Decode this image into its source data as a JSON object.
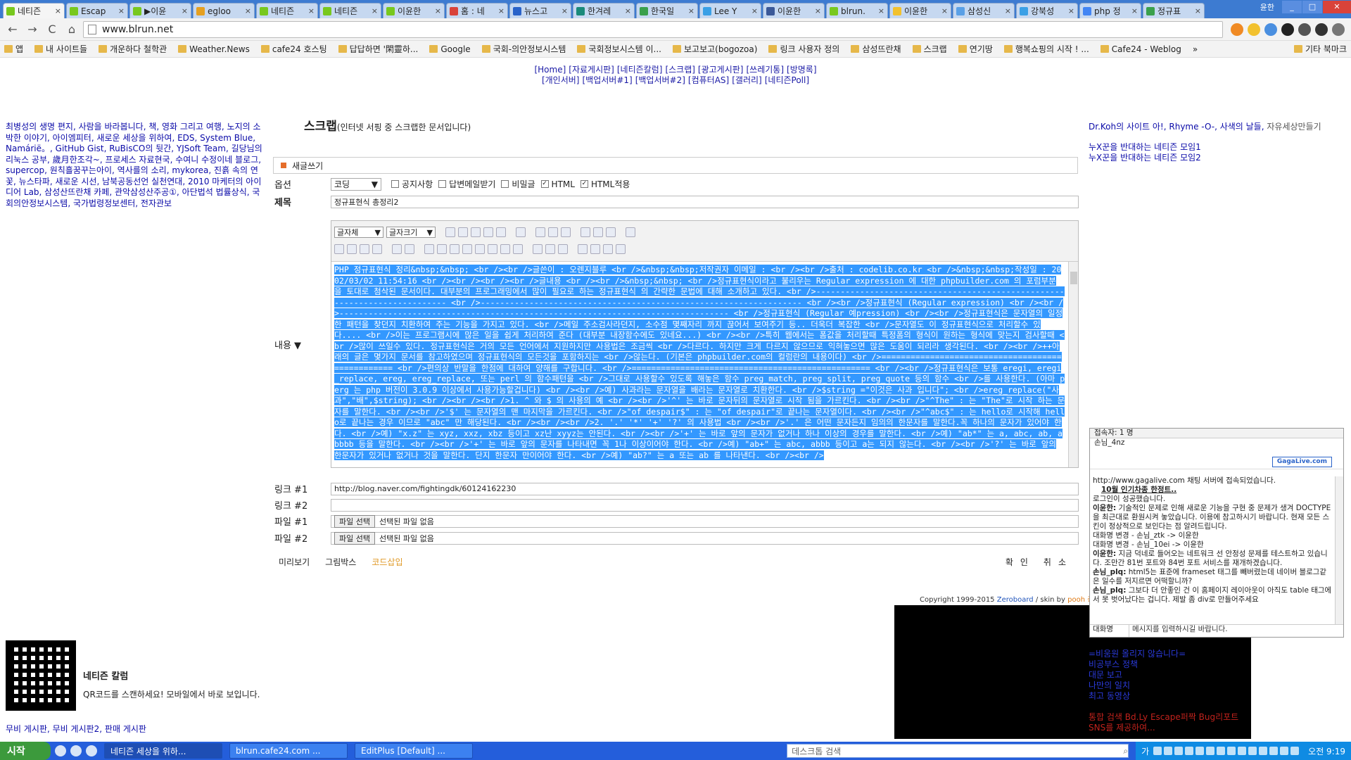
{
  "browser": {
    "tabs": [
      {
        "label": "네티즌",
        "color": "#78c81e",
        "active": true
      },
      {
        "label": "Escap",
        "color": "#78c81e"
      },
      {
        "label": "▶이윤",
        "color": "#78c81e"
      },
      {
        "label": "egloo",
        "color": "#e5a021"
      },
      {
        "label": "네티즌",
        "color": "#78c81e"
      },
      {
        "label": "네티즌",
        "color": "#78c81e"
      },
      {
        "label": "이윤한",
        "color": "#78c81e"
      },
      {
        "label": "홈 : 네",
        "color": "#d9433a"
      },
      {
        "label": "뉴스고",
        "color": "#2a63c9"
      },
      {
        "label": "한겨레",
        "color": "#1a8a7a"
      },
      {
        "label": "한국일",
        "color": "#3aa04c"
      },
      {
        "label": "Lee Y",
        "color": "#3aa0e6"
      },
      {
        "label": "이윤한",
        "color": "#3b5998"
      },
      {
        "label": "blrun.",
        "color": "#78c81e"
      },
      {
        "label": "이윤한",
        "color": "#f2c12e"
      },
      {
        "label": "삼성신",
        "color": "#5aa0e6"
      },
      {
        "label": "강북성",
        "color": "#3aa0e6"
      },
      {
        "label": "php 정",
        "color": "#4285f4"
      },
      {
        "label": "정규표",
        "color": "#3aa04c"
      }
    ],
    "user": "윤한",
    "win_min": "_",
    "win_max": "□",
    "win_close": "✕",
    "back_icon": "←",
    "forward_icon": "→",
    "reload_icon": "C",
    "home_icon": "⌂",
    "url": "www.blrun.net",
    "bookmarks": [
      "앱",
      "내 사이트들",
      "개운하다 철학관",
      "Weather.News",
      "cafe24 호스팅",
      "답답하면 '閑靈하...",
      "Google",
      "국회-의안정보시스템",
      "국회정보시스템 이...",
      "보고보고(bogozoa)",
      "링크 사용자 정의",
      "삼성뜨란채",
      "스크랩",
      "연기땅",
      "행복쇼핑의 시작 ! ...",
      "Cafe24 - Weblog"
    ],
    "bookmarks_more": "»",
    "other_bookmarks": "기타 북마크"
  },
  "topmenu": {
    "row1": [
      "[Home]",
      "[자료게시판]",
      "[네티즌칼럼]",
      "[스크랩]",
      "[광고게시판]",
      "[쓰레기통]",
      "[방명록]"
    ],
    "row2": [
      "[개인서버]",
      "[백업서버#1]",
      "[백업서버#2]",
      "[컴퓨터AS]",
      "[갤러리]",
      "[네티즌Poll]"
    ]
  },
  "left": {
    "links_text": "최병성의 생명 편지, 사람을 바라봅니다, 책, 영화 그리고 여행, 노지의 소박한 이야기, 아이엠피터, 새로운 세상을 위하여, EDS, System Blue, Namárië。, GitHub Gist, RuBisCO의 뒷간, YJSoft Team, 길당님의 리눅스 공부, 歲月한조각~, 프로세스 자료현국, 수여니 수정이네 블로그, supercop, 원칙흘꿈꾸는아이, 역사를의 소리, mykorea, 진흙 속의 연꽃, 뉴스타파, 새로운 시선, 남북공동선언 실천연대, 2010 마케터의 아이디어 Lab, 삼성산뜨란채 카페, 관악삼성산주공①, 아단법석 법률상식, 국회의안정보시스템, 국가법령정보센터, 전자관보",
    "qr_title": "네티즌 칼럼",
    "qr_text": "QR코드를 스캔하세요! 모바일에서 바로 보입니다.",
    "boards": "무비 게시판, 무비 게시판2, 판매 게시판"
  },
  "form": {
    "page_title": "스크랩",
    "page_subtitle": "(인터넷 서핑 중 스크랩한 문서입니다)",
    "write_label": "새글쓰기",
    "option_label": "옵션",
    "coding_select": "코딩",
    "checks": [
      {
        "label": "공지사항",
        "checked": false
      },
      {
        "label": "답변메일받기",
        "checked": false
      },
      {
        "label": "비밀글",
        "checked": false
      },
      {
        "label": "HTML",
        "checked": true
      },
      {
        "label": "HTML적용",
        "checked": true
      }
    ],
    "title_label": "제목",
    "title_value": "정규표현식 총정리2",
    "content_label": "내용 ▼",
    "font_select": "글자체",
    "size_select": "글자크기",
    "content_text": "PHP 정규표현식 정리&nbsp;&nbsp; <br /><br />글쓴이 : 오렌지블루 <br />&nbsp;&nbsp;저작권자 이메일 : <br /><br />출처 : codelib.co.kr <br />&nbsp;&nbsp;작성일 : 2002/03/02 11:54:16 <br /><br /><br /><br />글내용 <br /><br />&nbsp;&nbsp; <br />정규표현식이라고 불리우는 Regular expression 에 대한 phpbuilder.com 의 포럼부분 을 토대로 첨삭된 문서이다. 대부분의 프로그래밍에서 많이 필요로 하는 정규표현식 의 간략한 문법에 대해 소개하고 있다. <br />-------------------------------------------------------------------------- <br />------------------------------------------------------------------ <br /><br />정규표현식 (Regular expression) <br /><br />-------------------------------------------------------------------------------- <br />정규표현식 (Regular 예pression) <br /><br />정규표현식은 문자열의 일정한 패턴을 찾던지 치환하여 주는 기능을 가지고 있다. <br />메일 주소검사라던지, 소수점 몇째자리 까지 끊어서 보여주기 등.. 더욱더 복잡한 <br />문자열도 이 정규표현식으로 처리할수 있다.... <br />이는 프로그램시에 많은 일을 쉽게 처리하여 준다 (대부분 내장함수에도 있네요...) <br /><br />특히 웹에서는 폼값을 처리할때 특정폼의 형식이 원하는 형식에 맞는지 검사할때 <br />많이 쓰일수 있다. 정규표현식은 거의 모든 언어에서 지원하지만 사용법은 조금씩 <br />다르다. 하지만 크게 다르지 않으므로 익혀놓으면 많은 도움이 되리라 생각된다. <br /><br />++아래의 글은 몇가지 문서를 참고하였으며 정규표현식의 모든것을 포함하지는 <br />않는다. (기본은 phpbuilder.com의 컬럼란의 내용이다) <br />================================================= <br />편의상 반말을 한점에 대하여 양해를 구합니다. <br />================================================= <br /><br />정규표현식은 보통 eregi, eregi_replace, ereg, ereg_replace, 또는 perl 의 함수패턴을 <br />그대로 사용할수 있도록 해놓은 함수 preg_match, preg_split, preg_quote 등의 함수 <br />를 사용한다. (아마 perg 는 php 버전이 3.0.9 이상에서 사용가능할겁니다) <br /><br />예) 사과라는 문자열을 배라는 문자열로 치환한다. <br />$string =\"이것은 사과 입니다\"; <br />ereg_replace(\"사과\",\"배\",$string); <br /><br /><br />1. ^ 와 $ 의 사용의 예 <br /><br />'^' 는 바로 문자뒤의 문자열로 시작 됨을 가르킨다. <br /><br />\"^The\" : 는 \"The\"로 시작 하는 문자를 말한다. <br /><br />'$' 는 문자열의 맨 마지막을 가르킨다. <br />\"of despair$\" : 는 \"of despair\"로 끝나는 문자열이다. <br /><br />\"^abc$\" : 는 hello로 시작해 hello로 끝나는 경우 이므로 \"abc\" 만 해당된다. <br /><br /><br />2. '.' '*' '+' '?' 의 사용법 <br /><br />'.' 은 어떤 문자든지 임의의 한문자를 말한다.꼭 하나의 문자가 있어야 한다. <br />예) \"x.z\" 는 xyz, xxz, xbz 등이고 xz난 xyyz는 안된다. <br /><br />'+' 는 바로 앞의 문자가 없거나 하나 이상의 경우를 말한다. <br />예) \"ab*\" 는 a, abc, ab, abbbb 등을 말한다. <br /><br />'+' 는 바로 앞의 문자를 나타내면 꼭 1나 이상이어야 한다. <br />예) \"ab+\" 는 abc, abbb 등이고 a는 되지 않는다. <br /><br />'?' 는 바로 앞의 한문자가 있거나 없거나 것을 말한다. 단지 한문자 만이어야 한다. <br />예) \"ab?\" 는 a 또는 ab 를 나타낸다. <br /><br />",
    "link1_label": "링크 #1",
    "link1_value": "http://blog.naver.com/fightingdk/60124162230",
    "link2_label": "링크 #2",
    "link2_value": "",
    "file1_label": "파일 #1",
    "file2_label": "파일 #2",
    "file_button": "파일 선택",
    "file_none": "선택된 파일 없음",
    "preview": "미리보기",
    "picbox": "그림박스",
    "code_insert": "코드삽입",
    "confirm": "확인",
    "cancel": "취소"
  },
  "copyright": {
    "prefix": "Copyright 1999-2015",
    "zeroboard": "Zeroboard",
    "middle": "/ skin by",
    "author": "pooh 총"
  },
  "right": {
    "top_links": "Dr.Koh의 사이트 아!, Rhyme -O-, 사색의 날들,",
    "top_gray": "자유세상만들기",
    "groups": [
      "누X꾼을 반대하는 네티즌 모임1",
      "누X꾼을 반대하는 네티즌 모임2"
    ]
  },
  "chat": {
    "header": "접속자: 1 명",
    "users": "손님_4nz",
    "brand": "GagaLive.com",
    "log": [
      {
        "text": "http://www.gagalive.com 채팅 서버에 접속되었습니다."
      },
      {
        "text": "10월 인기차종 한정트..",
        "bold": true
      },
      {
        "text": "로그인이 성공했습니다."
      },
      {
        "nick": "이윤한:",
        "text": "기술적인 문제로 인해 새로운 기능을 구현 중 문제가 생겨 DOCTYPE 을 최근대로 환원시켜 놓았습니다. 이용에 참고하시기 바랍니다. 현재 모든 스킨이 정상적으로 보인다는 점 알려드립니다."
      },
      {
        "text": "대화명 변경 - 손님_ztk -> 이윤한"
      },
      {
        "text": "대화명 변경 - 손님_10ei -> 이윤한"
      },
      {
        "nick": "이윤한:",
        "text": "지금 덕네로 들어오는 네트워크 선 안정성 문제를 테스트하고 있습니다. 조만간 81번 포트와 84번 포트 서비스를 재개하겠습니다."
      },
      {
        "nick": "손님_plq:",
        "text": "html5는 표준에 frameset 태그를 빼버렸는데 네이버 블로그같은 일수를 저지르면 어떡할니까?"
      },
      {
        "nick": "손님_plq:",
        "text": "그보다 더 안좋인 건 이 홈페이지 레이아웃이 아직도 table 태그에서 못 벗어났다는 겁니다. 제발 좀 div로 만들어주세요"
      }
    ],
    "nick_label": "대화명",
    "input_placeholder": "메시지를 입력하시길 바랍니다."
  },
  "blue_block": [
    "=비움원 올리지 않습니다=",
    "비공부스 정책",
    "대문 보고",
    "나만의 일치",
    "최고 동영상"
  ],
  "red_block": [
    "통합 검색 Bd.Ly Escape퍼짝 Bug리포트",
    "SNS를 제공하여..."
  ],
  "taskbar": {
    "start": "시작",
    "windows": [
      "네티즌 세상을 위하...",
      "blrun.cafe24.com ...",
      "EditPlus [Default] ..."
    ],
    "search_placeholder": "데스크톱 검색",
    "tray_lang": "가",
    "clock": "오전 9:19"
  }
}
